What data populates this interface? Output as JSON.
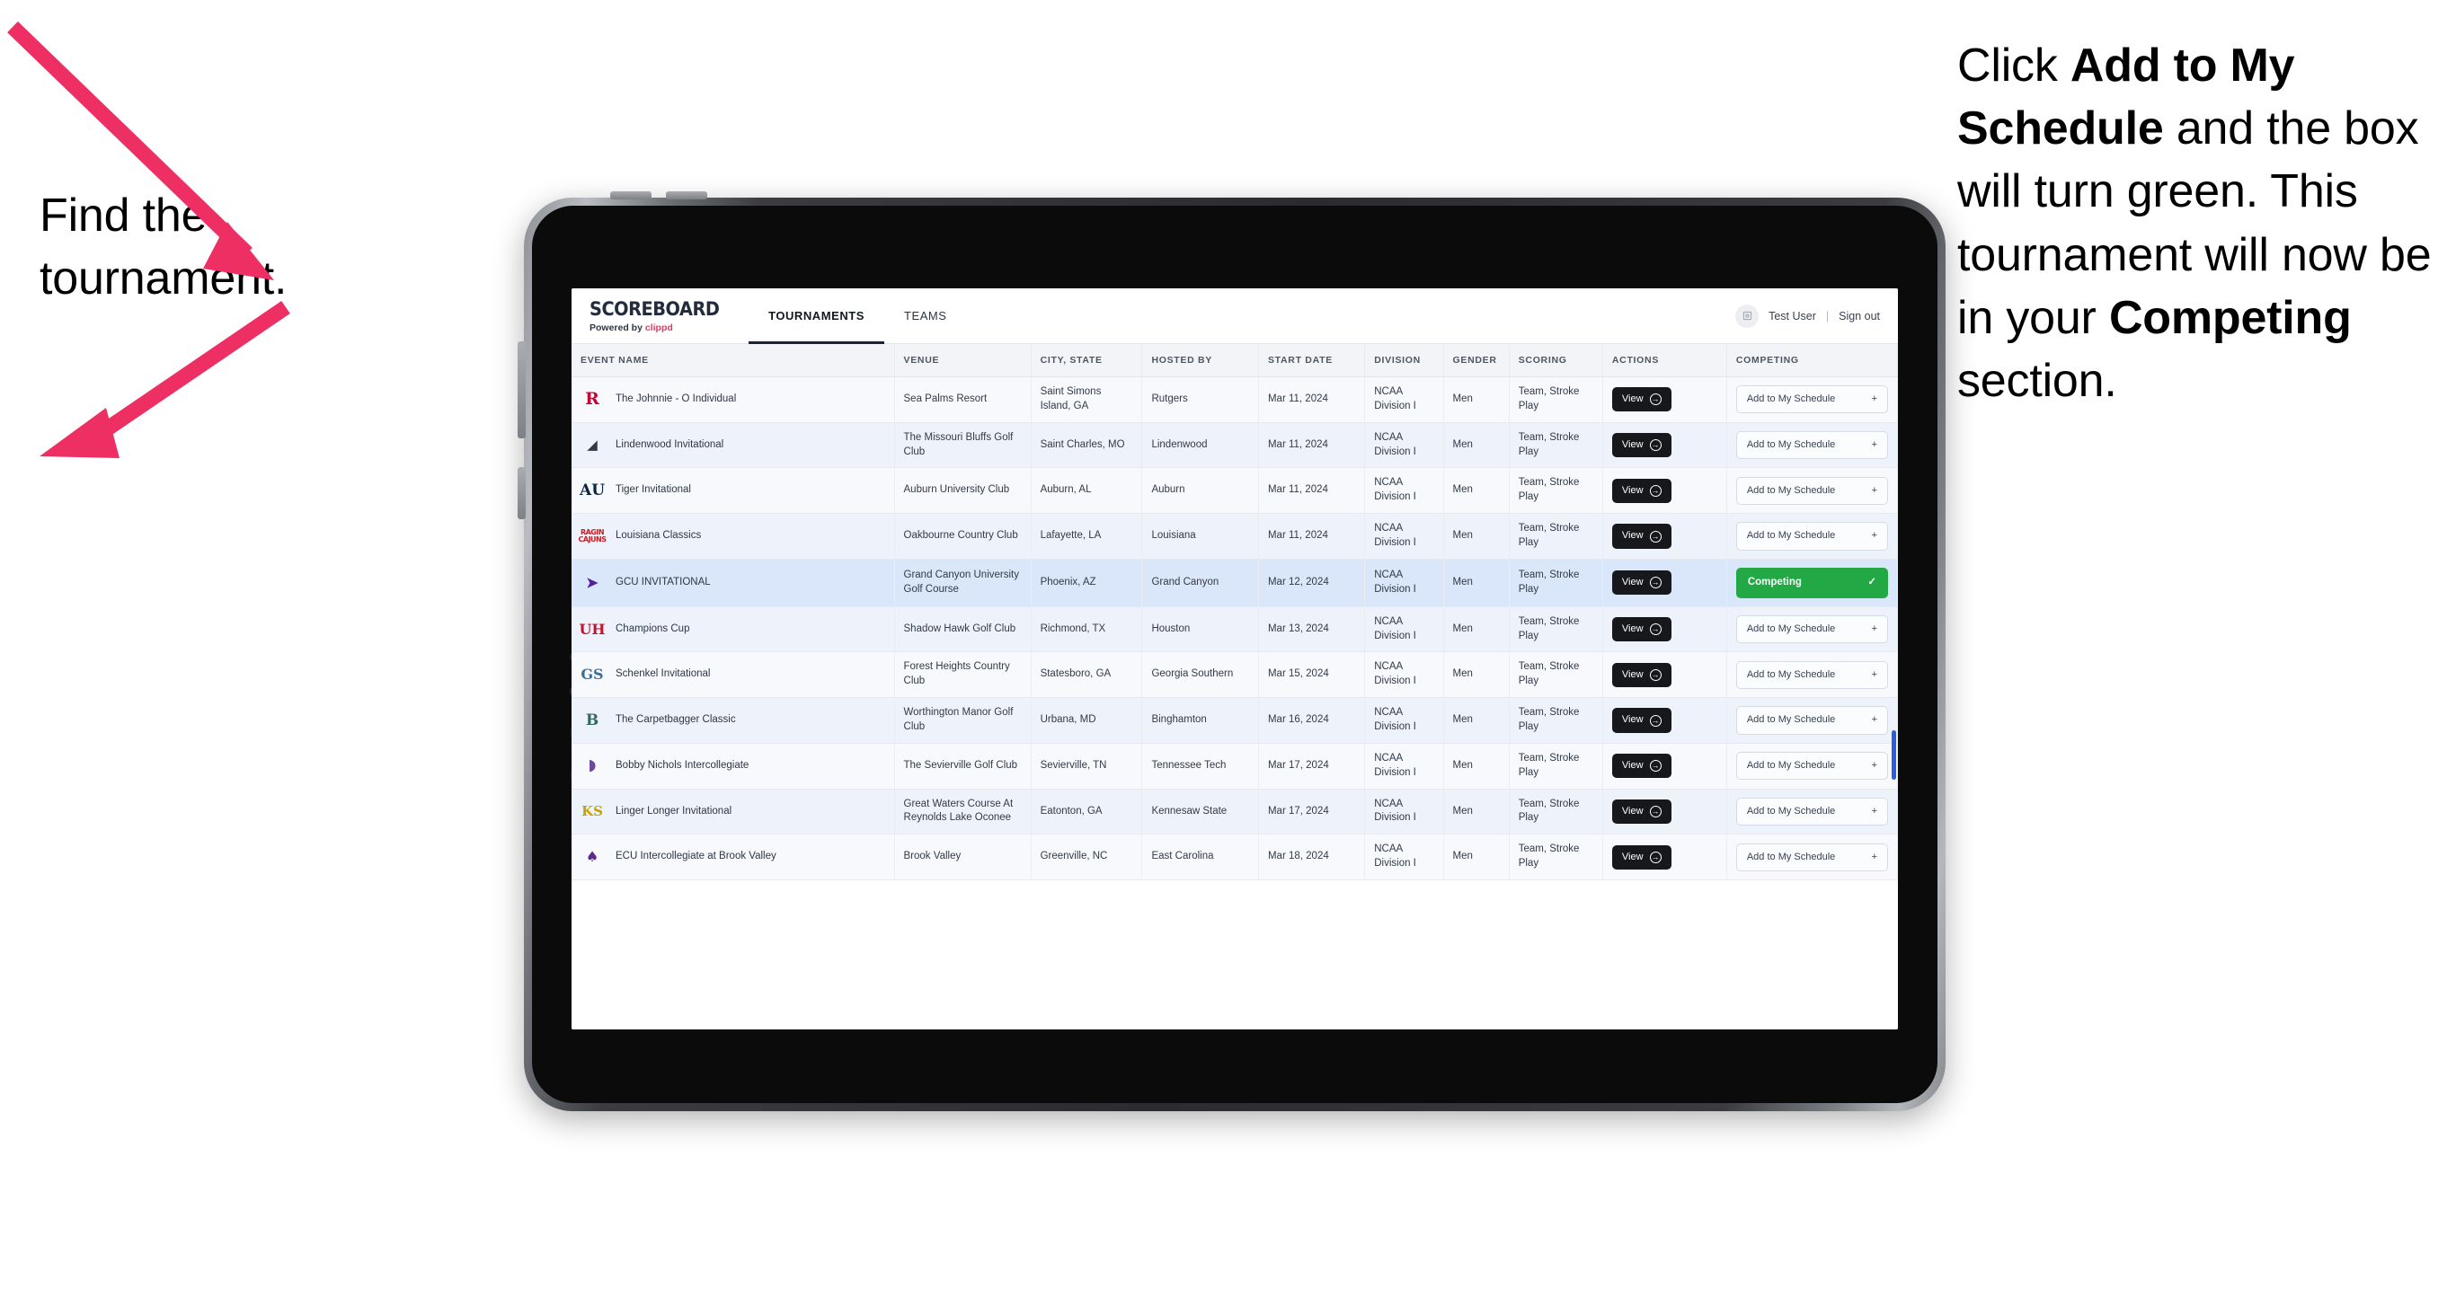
{
  "annotations": {
    "left": "Find the tournament.",
    "right_parts": [
      {
        "text": "Click ",
        "bold": false
      },
      {
        "text": "Add to My Schedule",
        "bold": true
      },
      {
        "text": " and the box will turn green. This tournament will now be in your ",
        "bold": false
      },
      {
        "text": "Competing",
        "bold": true
      },
      {
        "text": " section.",
        "bold": false
      }
    ],
    "arrow_color": "#ee2f63"
  },
  "app": {
    "brand": {
      "title": "SCOREBOARD",
      "powered_prefix": "Powered by ",
      "powered_brand": "clippd"
    },
    "nav": [
      {
        "label": "TOURNAMENTS",
        "active": true
      },
      {
        "label": "TEAMS",
        "active": false
      }
    ],
    "user": {
      "avatar_icon": "user-avatar-icon",
      "name": "Test User",
      "divider": "|",
      "signout": "Sign out"
    }
  },
  "table": {
    "columns": [
      "EVENT NAME",
      "VENUE",
      "CITY, STATE",
      "HOSTED BY",
      "START DATE",
      "DIVISION",
      "GENDER",
      "SCORING",
      "ACTIONS",
      "COMPETING"
    ],
    "view_label": "View",
    "add_label": "Add to My Schedule",
    "add_icon": "plus-icon",
    "competing_label": "Competing",
    "competing_icon": "check-icon",
    "competing_color": "#22a844",
    "rows": [
      {
        "logo": "rutgers-logo",
        "logo_glyph": "R",
        "logo_class": "rutgers",
        "event": "The Johnnie - O Individual",
        "venue": "Sea Palms Resort",
        "city": "Saint Simons Island, GA",
        "host": "Rutgers",
        "date": "Mar 11, 2024",
        "division": "NCAA Division I",
        "gender": "Men",
        "scoring": "Team, Stroke Play",
        "competing": false
      },
      {
        "logo": "lindenwood-logo",
        "logo_glyph": "◢",
        "logo_class": "lind",
        "event": "Lindenwood Invitational",
        "venue": "The Missouri Bluffs Golf Club",
        "city": "Saint Charles, MO",
        "host": "Lindenwood",
        "date": "Mar 11, 2024",
        "division": "NCAA Division I",
        "gender": "Men",
        "scoring": "Team, Stroke Play",
        "competing": false
      },
      {
        "logo": "auburn-logo",
        "logo_glyph": "AU",
        "logo_class": "auburn",
        "event": "Tiger Invitational",
        "venue": "Auburn University Club",
        "city": "Auburn, AL",
        "host": "Auburn",
        "date": "Mar 11, 2024",
        "division": "NCAA Division I",
        "gender": "Men",
        "scoring": "Team, Stroke Play",
        "competing": false
      },
      {
        "logo": "louisiana-ragin-cajuns-logo",
        "logo_glyph": "RAGIN CAJUNS",
        "logo_class": "ragin",
        "event": "Louisiana Classics",
        "venue": "Oakbourne Country Club",
        "city": "Lafayette, LA",
        "host": "Louisiana",
        "date": "Mar 11, 2024",
        "division": "NCAA Division I",
        "gender": "Men",
        "scoring": "Team, Stroke Play",
        "competing": false
      },
      {
        "logo": "grand-canyon-lopes-logo",
        "logo_glyph": "➤",
        "logo_class": "gcu",
        "event": "GCU INVITATIONAL",
        "venue": "Grand Canyon University Golf Course",
        "city": "Phoenix, AZ",
        "host": "Grand Canyon",
        "date": "Mar 12, 2024",
        "division": "NCAA Division I",
        "gender": "Men",
        "scoring": "Team, Stroke Play",
        "competing": true
      },
      {
        "logo": "houston-cougars-logo",
        "logo_glyph": "UH",
        "logo_class": "houston",
        "event": "Champions Cup",
        "venue": "Shadow Hawk Golf Club",
        "city": "Richmond, TX",
        "host": "Houston",
        "date": "Mar 13, 2024",
        "division": "NCAA Division I",
        "gender": "Men",
        "scoring": "Team, Stroke Play",
        "competing": false
      },
      {
        "logo": "georgia-southern-logo",
        "logo_glyph": "GS",
        "logo_class": "gasou",
        "event": "Schenkel Invitational",
        "venue": "Forest Heights Country Club",
        "city": "Statesboro, GA",
        "host": "Georgia Southern",
        "date": "Mar 15, 2024",
        "division": "NCAA Division I",
        "gender": "Men",
        "scoring": "Team, Stroke Play",
        "competing": false
      },
      {
        "logo": "binghamton-bearcats-logo",
        "logo_glyph": "B",
        "logo_class": "bingh",
        "event": "The Carpetbagger Classic",
        "venue": "Worthington Manor Golf Club",
        "city": "Urbana, MD",
        "host": "Binghamton",
        "date": "Mar 16, 2024",
        "division": "NCAA Division I",
        "gender": "Men",
        "scoring": "Team, Stroke Play",
        "competing": false
      },
      {
        "logo": "tennessee-tech-golden-eagles-logo",
        "logo_glyph": "◗",
        "logo_class": "ttech",
        "event": "Bobby Nichols Intercollegiate",
        "venue": "The Sevierville Golf Club",
        "city": "Sevierville, TN",
        "host": "Tennessee Tech",
        "date": "Mar 17, 2024",
        "division": "NCAA Division I",
        "gender": "Men",
        "scoring": "Team, Stroke Play",
        "competing": false
      },
      {
        "logo": "kennesaw-state-owls-logo",
        "logo_glyph": "KS",
        "logo_class": "kennesaw",
        "event": "Linger Longer Invitational",
        "venue": "Great Waters Course At Reynolds Lake Oconee",
        "city": "Eatonton, GA",
        "host": "Kennesaw State",
        "date": "Mar 17, 2024",
        "division": "NCAA Division I",
        "gender": "Men",
        "scoring": "Team, Stroke Play",
        "competing": false
      },
      {
        "logo": "east-carolina-pirates-logo",
        "logo_glyph": "♠",
        "logo_class": "ecu",
        "event": "ECU Intercollegiate at Brook Valley",
        "venue": "Brook Valley",
        "city": "Greenville, NC",
        "host": "East Carolina",
        "date": "Mar 18, 2024",
        "division": "NCAA Division I",
        "gender": "Men",
        "scoring": "Team, Stroke Play",
        "competing": false
      }
    ]
  }
}
